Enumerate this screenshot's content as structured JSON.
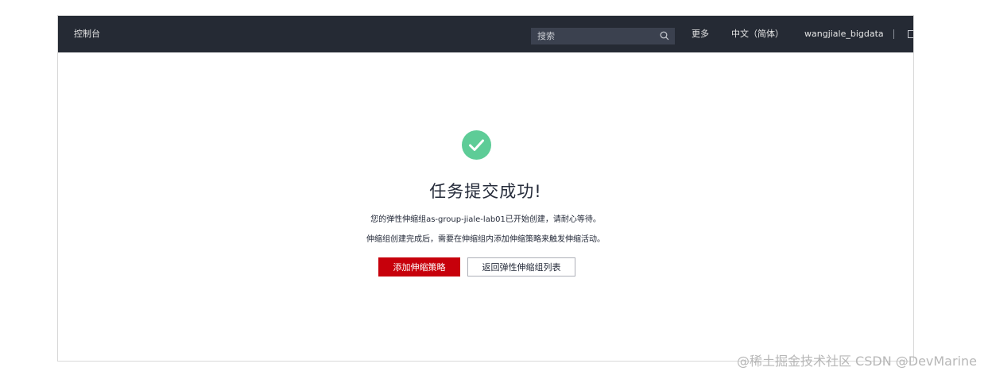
{
  "topbar": {
    "console_label": "控制台",
    "search_placeholder": "搜索",
    "more_label": "更多",
    "language_label": "中文（简体）",
    "username": "wangjiale_bigdata"
  },
  "result": {
    "icon": "success-check-icon",
    "title": "任务提交成功!",
    "line1": "您的弹性伸缩组as-group-jiale-lab01已开始创建，请耐心等待。",
    "line2": "伸缩组创建完成后，需要在伸缩组内添加伸缩策略来触发伸缩活动。",
    "primary_button": "添加伸缩策略",
    "secondary_button": "返回弹性伸缩组列表"
  },
  "watermark": "@稀土掘金技术社区 CSDN @DevMarine",
  "colors": {
    "topbar_bg": "#252a34",
    "success_green": "#5ecc97",
    "primary_red": "#c7000b"
  }
}
